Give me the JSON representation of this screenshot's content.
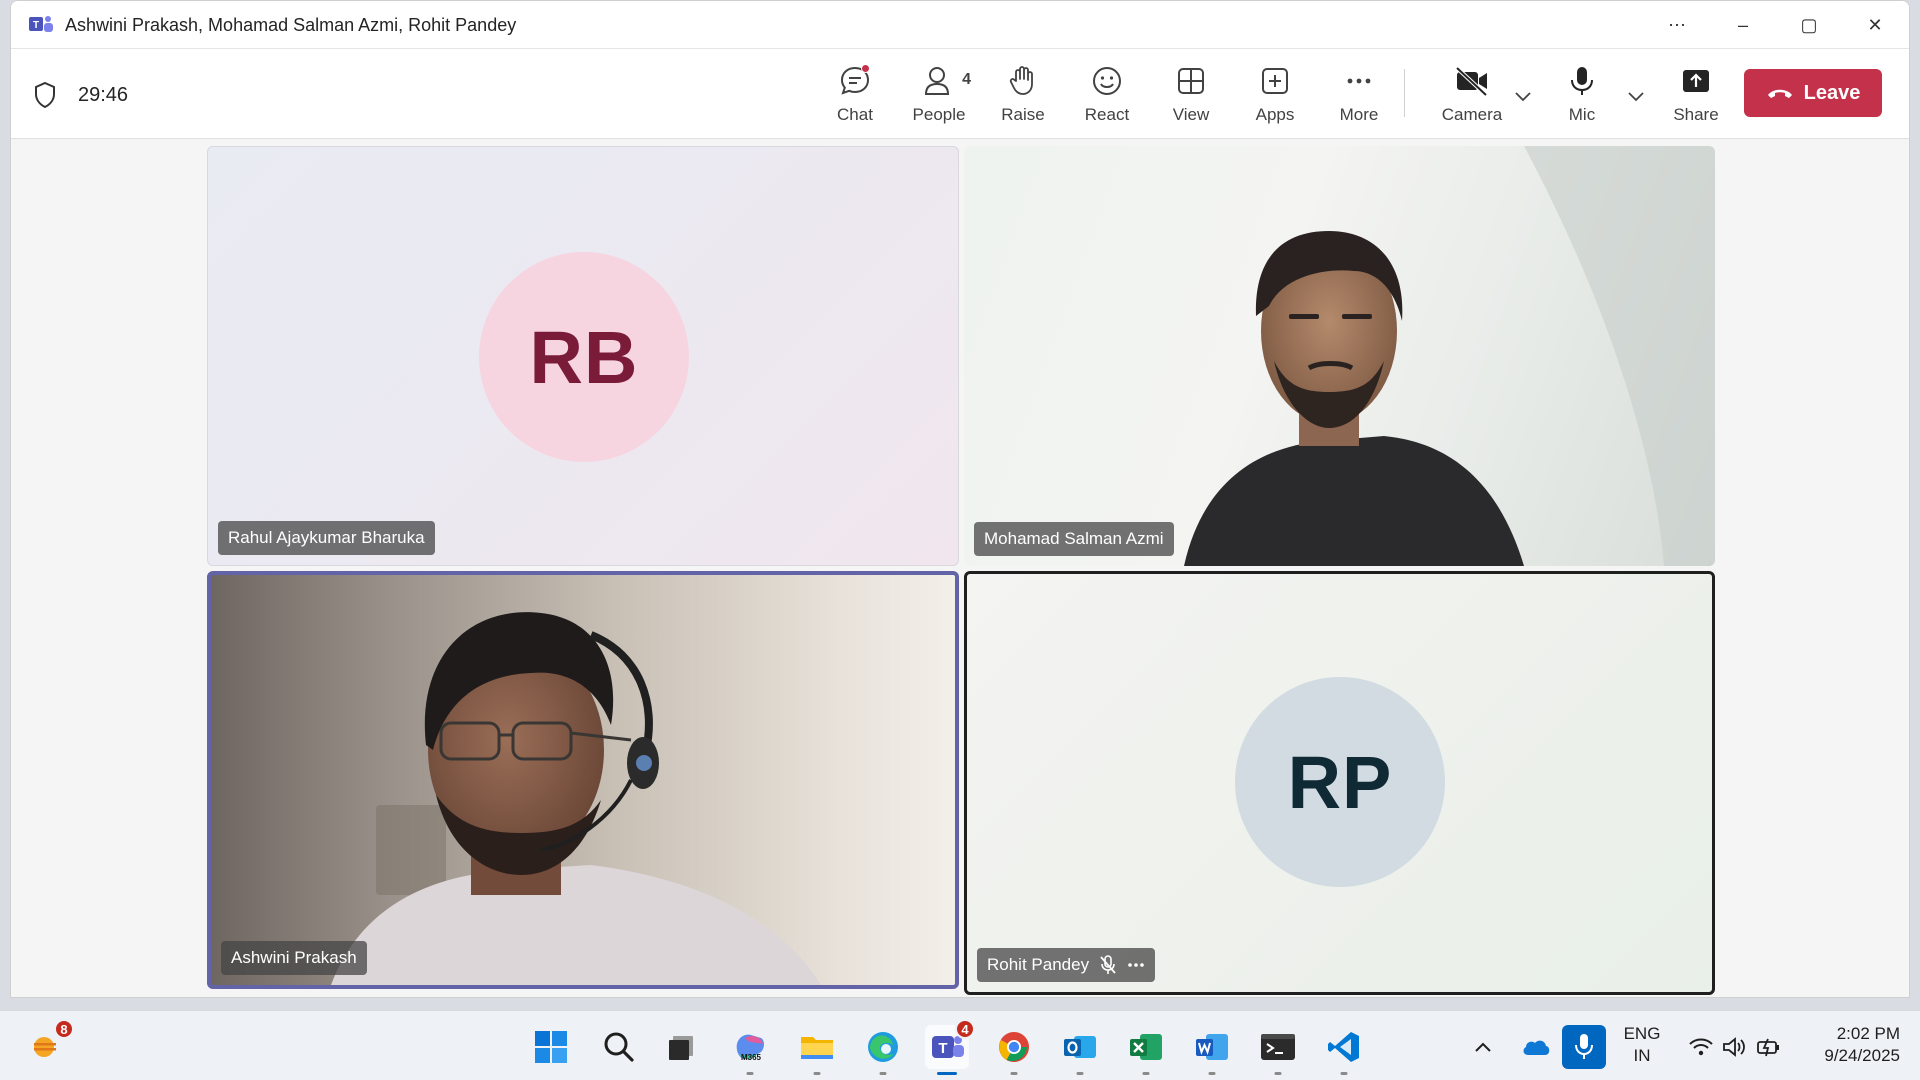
{
  "window": {
    "title": "Ashwini Prakash, Mohamad Salman Azmi, Rohit Pandey",
    "controls": {
      "more": "⋯",
      "minimize": "–",
      "maximize": "▢",
      "close": "✕"
    }
  },
  "toolbar": {
    "timer": "29:46",
    "chat_label": "Chat",
    "people_label": "People",
    "people_count": "4",
    "raise_label": "Raise",
    "react_label": "React",
    "view_label": "View",
    "apps_label": "Apps",
    "more_label": "More",
    "camera_label": "Camera",
    "mic_label": "Mic",
    "share_label": "Share",
    "leave_label": "Leave",
    "leave_color": "#c4314b"
  },
  "participants": [
    {
      "name": "Rahul Ajaykumar Bharuka",
      "initials": "RB",
      "video": false,
      "avatar_color": "#f6d5e0"
    },
    {
      "name": "Mohamad Salman Azmi",
      "initials": "",
      "video": true
    },
    {
      "name": "Ashwini Prakash",
      "initials": "",
      "video": true,
      "active_speaker": true
    },
    {
      "name": "Rohit Pandey",
      "initials": "RP",
      "video": false,
      "muted": true,
      "avatar_color": "#d1dbe1"
    }
  ],
  "taskbar": {
    "weather_badge": "8",
    "teams_badge": "4",
    "apps": [
      "start-icon",
      "search-icon",
      "task-view-icon",
      "m365-copilot-icon",
      "file-explorer-icon",
      "edge-icon",
      "teams-icon",
      "chrome-icon",
      "outlook-icon",
      "excel-icon",
      "word-icon",
      "terminal-icon",
      "vscode-icon"
    ],
    "language_line1": "ENG",
    "language_line2": "IN",
    "time": "2:02 PM",
    "date": "9/24/2025"
  }
}
